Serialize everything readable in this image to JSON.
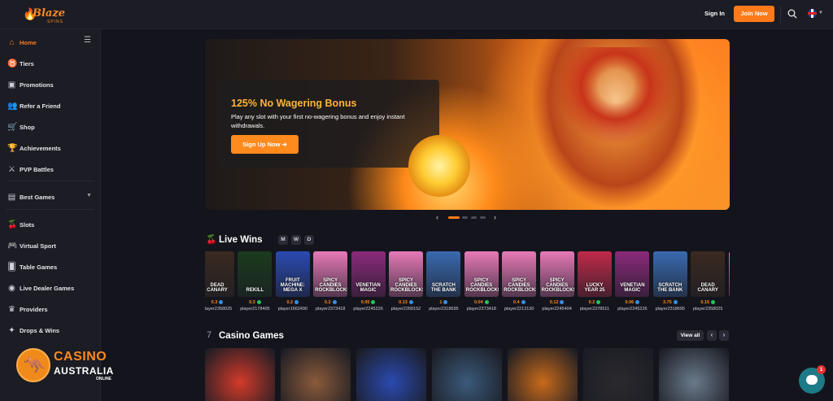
{
  "brand": {
    "name": "Blaze",
    "sub": "SPINS"
  },
  "header": {
    "signin": "Sign In",
    "join": "Join Now"
  },
  "sidebar": {
    "items": [
      {
        "label": "Home",
        "icon": "home-icon"
      },
      {
        "label": "Tiers",
        "icon": "medal-icon"
      },
      {
        "label": "Promotions",
        "icon": "gift-icon"
      },
      {
        "label": "Refer a Friend",
        "icon": "users-icon"
      },
      {
        "label": "Shop",
        "icon": "cart-icon"
      },
      {
        "label": "Achievements",
        "icon": "trophy-icon"
      },
      {
        "label": "PVP Battles",
        "icon": "swords-icon"
      },
      {
        "label": "Best Games",
        "icon": "star-icon"
      },
      {
        "label": "Slots",
        "icon": "cherry-icon"
      },
      {
        "label": "Virtual Sport",
        "icon": "gamepad-icon"
      },
      {
        "label": "Table Games",
        "icon": "cards-icon"
      },
      {
        "label": "Live Dealer Games",
        "icon": "dealer-icon"
      },
      {
        "label": "Providers",
        "icon": "providers-icon"
      },
      {
        "label": "Drops & Wins",
        "icon": "drops-icon"
      }
    ]
  },
  "hero": {
    "title": "125% No Wagering Bonus",
    "text": "Play any slot with your first no-wagering bonus and enjoy instant withdrawals.",
    "cta": "Sign Up Now ➔"
  },
  "live_wins": {
    "title": "Live Wins",
    "filters": [
      "M",
      "W",
      "D"
    ],
    "items": [
      {
        "game": "DEAD CANARY",
        "amount": "0.3",
        "player": "player2358025",
        "color": "#3a2a20"
      },
      {
        "game": "REKILL",
        "amount": "0.3",
        "player": "player2178405",
        "color": "#1b3b1e"
      },
      {
        "game": "FRUIT MACHINE: MEGA X",
        "amount": "0.2",
        "player": "player1662490",
        "color": "#2a4ab0"
      },
      {
        "game": "SPICY CANDIES ROCKBLOCKS",
        "amount": "0.2",
        "player": "player2373418",
        "color": "#e67ab8"
      },
      {
        "game": "VENETIAN MAGIC",
        "amount": "0.05",
        "player": "player2245226",
        "color": "#8a2a7a"
      },
      {
        "game": "SPICY CANDIES ROCKBLOCKS",
        "amount": "0.13",
        "player": "player2268152",
        "color": "#e67ab8"
      },
      {
        "game": "SCRATCH THE BANK",
        "amount": "1",
        "player": "player2318695",
        "color": "#3a6ab0"
      },
      {
        "game": "SPICY CANDIES ROCKBLOCKS",
        "amount": "0.04",
        "player": "player2373418",
        "color": "#e67ab8"
      },
      {
        "game": "SPICY CANDIES ROCKBLOCKS",
        "amount": "0.4",
        "player": "player2213130",
        "color": "#e67ab8"
      },
      {
        "game": "SPICY CANDIES ROCKBLOCKS",
        "amount": "0.12",
        "player": "player2245404",
        "color": "#e67ab8"
      },
      {
        "game": "LUCKY YEAR 25",
        "amount": "0.2",
        "player": "player2378511",
        "color": "#c02a4a"
      },
      {
        "game": "VENETIAN MAGIC",
        "amount": "0.06",
        "player": "player2245226",
        "color": "#8a2a7a"
      },
      {
        "game": "SCRATCH THE BANK",
        "amount": "3.75",
        "player": "player2318695",
        "color": "#3a6ab0"
      },
      {
        "game": "DEAD CANARY",
        "amount": "0.15",
        "player": "player2358025",
        "color": "#3a2a20"
      },
      {
        "game": "",
        "amount": "",
        "player": "",
        "color": "#e67ab8"
      }
    ]
  },
  "casino_games": {
    "title": "Casino Games",
    "view_all": "View all",
    "tiles": [
      "#d33a2a",
      "#8a5a3a",
      "#2a4ab0",
      "#3a5a7a",
      "#c86a1a",
      "#2a2a2e",
      "#6a7a8a"
    ]
  },
  "overlay_logo": {
    "line1": "CASINO",
    "line2": "AUSTRALIA",
    "line3": "ONLINE"
  },
  "chat": {
    "badge": "1"
  }
}
